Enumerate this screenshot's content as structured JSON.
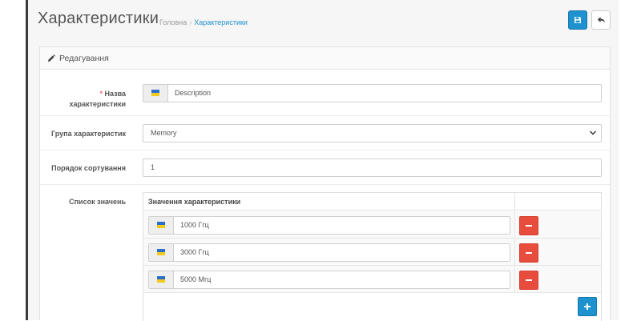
{
  "header": {
    "title": "Характеристики",
    "breadcrumb": {
      "home": "Головна",
      "separator": "›",
      "current": "Характеристики"
    },
    "save_icon": "save-icon",
    "back_icon": "reply-icon"
  },
  "panel": {
    "heading": "Редагування",
    "heading_icon": "pencil-icon"
  },
  "form": {
    "name": {
      "required_mark": "*",
      "label_line1": "Назва",
      "label_line2": "характеристики",
      "value": "Description",
      "flag_icon": "ukraine-flag-icon"
    },
    "group": {
      "label": "Група характеристик",
      "selected": "Memory"
    },
    "sort_order": {
      "label": "Порядок сортування",
      "value": "1"
    },
    "values_list": {
      "label": "Список значень",
      "column_header": "Значення характеристики",
      "items": [
        {
          "value": "1000 Ггц"
        },
        {
          "value": "3000 Ггц"
        },
        {
          "value": "5000 Мгц"
        }
      ]
    }
  },
  "colors": {
    "primary": "#1e91cf",
    "danger": "#e74c3c",
    "required": "#f56b6b"
  }
}
